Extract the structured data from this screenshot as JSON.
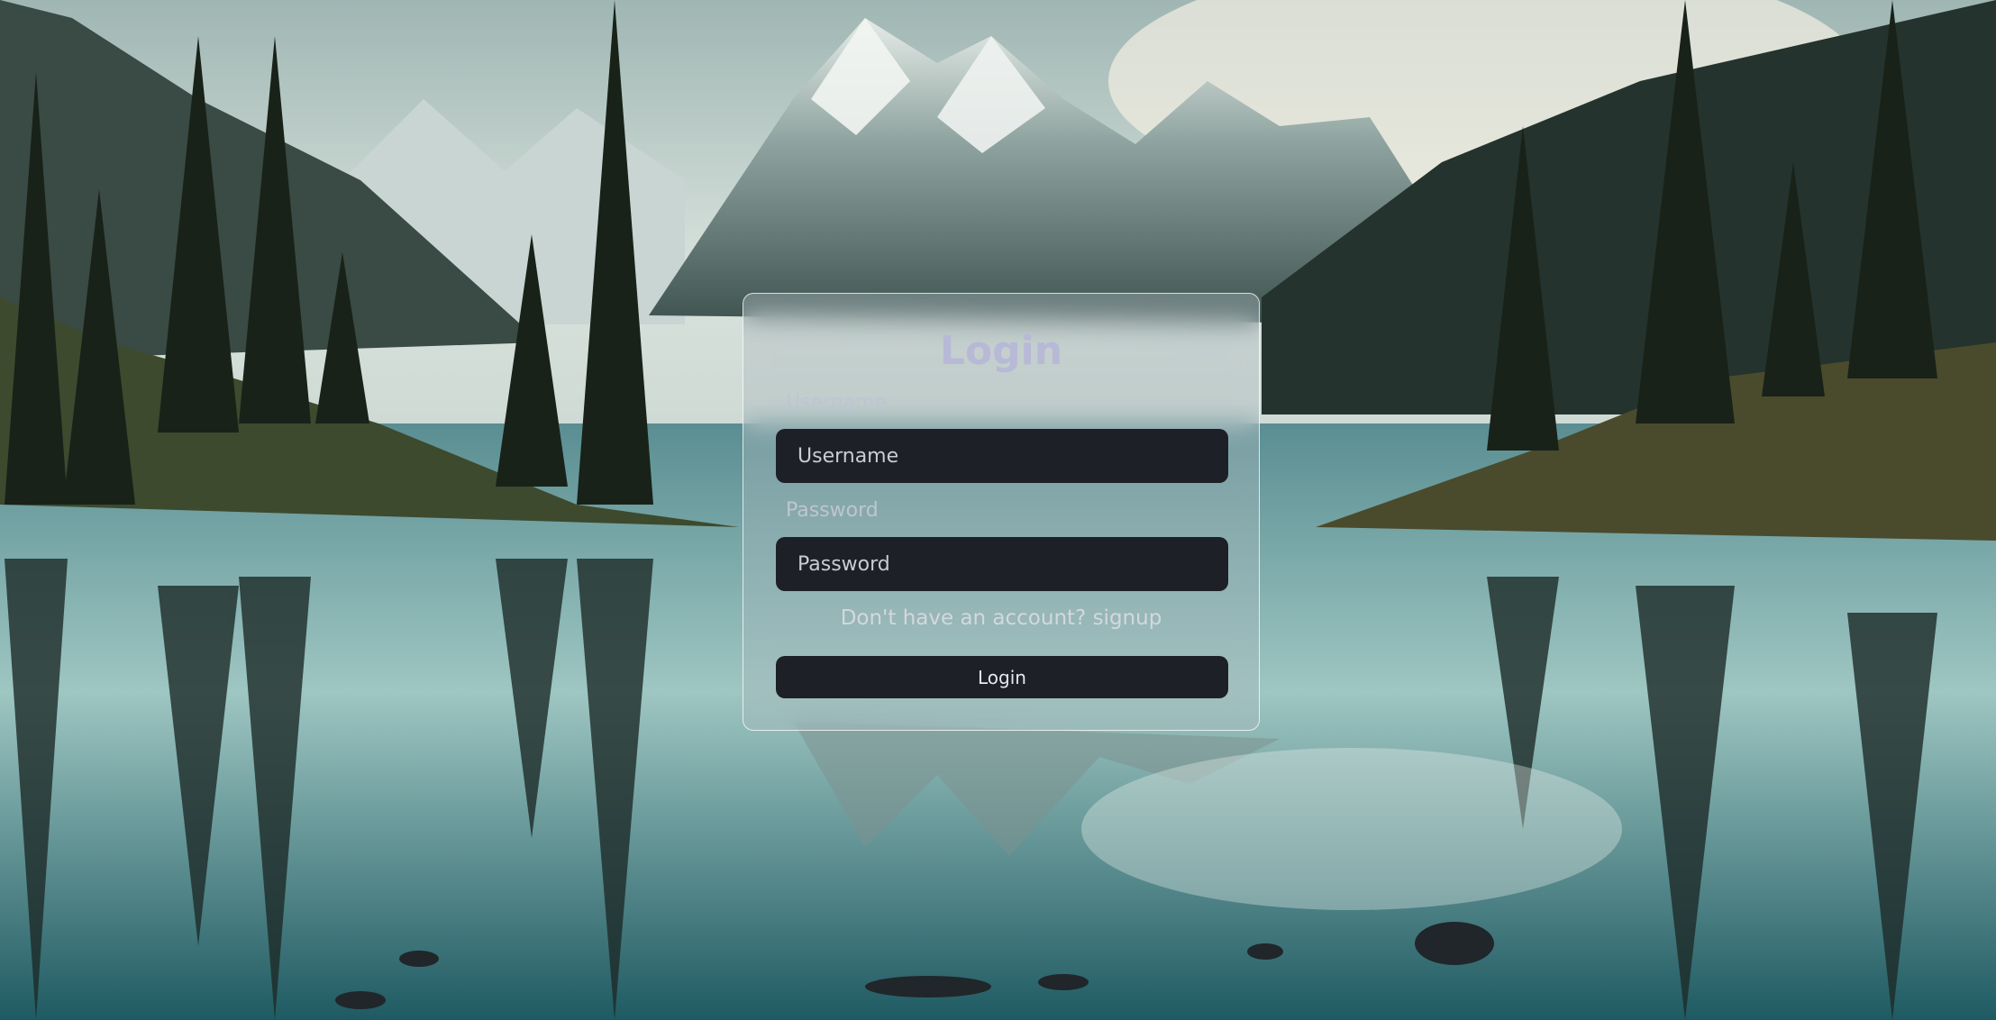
{
  "login": {
    "title": "Login",
    "username_label": "Username",
    "username_placeholder": "Username",
    "password_label": "Password",
    "password_placeholder": "Password",
    "signup_text": "Don't have an account? signup",
    "submit_label": "Login"
  },
  "background": {
    "sky_color": "#d8e2dc",
    "mountain_color": "#a8b8b4",
    "forest_color": "#1f2a24",
    "lake_color": "#3f7c82"
  }
}
